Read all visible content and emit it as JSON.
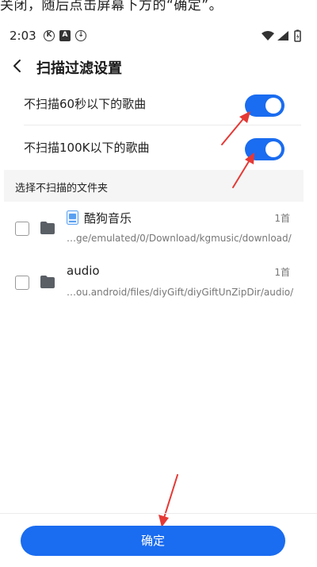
{
  "caption": "关闭，随后点击屏幕下方的“确定”。",
  "status_bar": {
    "time": "2:03",
    "icons": [
      "k-icon",
      "a-icon",
      "download-icon"
    ],
    "system_icons": [
      "wifi-icon",
      "signal-icon",
      "battery-icon"
    ]
  },
  "header": {
    "title": "扫描过滤设置"
  },
  "settings": [
    {
      "label": "不扫描60秒以下的歌曲",
      "enabled": true
    },
    {
      "label": "不扫描100K以下的歌曲",
      "enabled": true
    }
  ],
  "folder_section": {
    "label": "选择不扫描的文件夹"
  },
  "folders": [
    {
      "name": "酷狗音乐",
      "path": "…ge/emulated/0/Download/kgmusic/download/",
      "count": "1首",
      "checked": false,
      "app_icon": "kugou-app-icon"
    },
    {
      "name": "audio",
      "path": "…ou.android/files/diyGift/diyGiftUnZipDir/audio/",
      "count": "1首",
      "checked": false
    }
  ],
  "confirm_button": {
    "label": "确定"
  },
  "colors": {
    "accent": "#1a6cf0",
    "annotation_arrow": "#e53935",
    "section_background": "#f5f5f5"
  }
}
